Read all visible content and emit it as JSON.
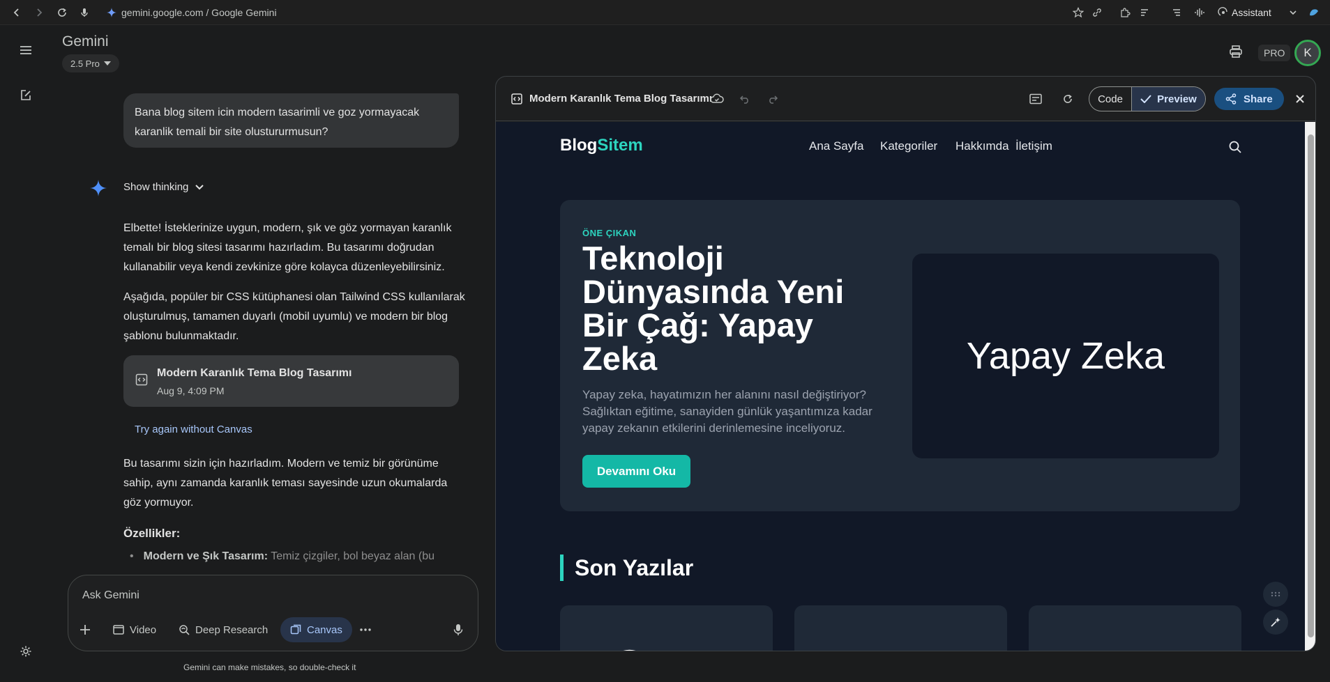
{
  "browser": {
    "url": "gemini.google.com / Google Gemini",
    "assistant_label": "Assistant"
  },
  "app": {
    "title": "Gemini",
    "model": "2.5 Pro",
    "pro_badge": "PRO",
    "avatar_letter": "K"
  },
  "chat": {
    "user_message": "Bana blog sitem icin modern tasarimli ve goz yormayacak karanlik temali bir site olustururmusun?",
    "show_thinking": "Show thinking",
    "paragraph1": "Elbette! İsteklerinize uygun, modern, şık ve göz yormayan karanlık temalı bir blog sitesi tasarımı hazırladım. Bu tasarımı doğrudan kullanabilir veya kendi zevkinize göre kolayca düzenleyebilirsiniz.",
    "paragraph2": "Aşağıda, popüler bir CSS kütüphanesi olan Tailwind CSS kullanılarak oluşturulmuş, tamamen duyarlı (mobil uyumlu) ve modern bir blog şablonu bulunmaktadır.",
    "doc_card": {
      "title": "Modern Karanlık Tema Blog Tasarımı",
      "date": "Aug 9, 4:09 PM"
    },
    "try_again": "Try again without Canvas",
    "paragraph3": "Bu tasarımı sizin için hazırladım. Modern ve temiz bir görünüme sahip, aynı zamanda karanlık teması sayesinde uzun okumalarda göz yormuyor.",
    "features_heading": "Özellikler:",
    "bullet1_bold": "Modern ve Şık Tasarım:",
    "bullet1_text": " Temiz çizgiler, bol beyaz alan (bu"
  },
  "input": {
    "placeholder": "Ask Gemini",
    "tools": {
      "video": "Video",
      "deep_research": "Deep Research",
      "canvas": "Canvas"
    },
    "disclaimer": "Gemini can make mistakes, so double-check it"
  },
  "canvas": {
    "title": "Modern Karanlık Tema Blog Tasarımı",
    "code_label": "Code",
    "preview_label": "Preview",
    "share_label": "Share"
  },
  "site": {
    "logo_part1": "Blog",
    "logo_part2": "Sitem",
    "nav": [
      "Ana Sayfa",
      "Kategoriler",
      "Hakkımda",
      "İletişim"
    ],
    "hero": {
      "tag": "ÖNE ÇIKAN",
      "title": "Teknoloji Dünyasında Yeni Bir Çağ: Yapay Zeka",
      "description": "Yapay zeka, hayatımızın her alanını nasıl değiştiriyor? Sağlıktan eğitime, sanayiden günlük yaşantımıza kadar yapay zekanın etkilerini derinlemesine inceliyoruz.",
      "button": "Devamını Oku",
      "image_text": "Yapay Zeka"
    },
    "section_title": "Son Yazılar"
  },
  "colors": {
    "accent_teal": "#2dd4bf",
    "button_teal": "#14b8a6",
    "link_blue": "#a8c7fa",
    "site_bg": "#111827",
    "card_bg": "#1f2937"
  }
}
